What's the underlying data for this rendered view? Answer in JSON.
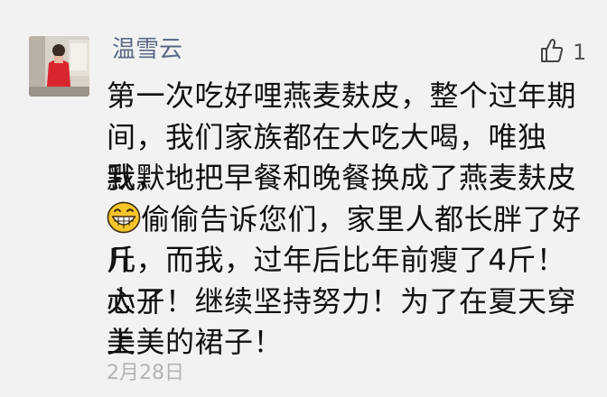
{
  "comment": {
    "username": "温雪云",
    "like_count": "1",
    "date": "2月28日",
    "lines": [
      {
        "text": "第一次吃好哩燕麦麸皮，整个过年期",
        "emoji_before": false,
        "emoji_after": false
      },
      {
        "text": "间，我们家族都在大吃大喝，唯独我，",
        "emoji_before": false,
        "emoji_after": false
      },
      {
        "text": "默默地把早餐和晚餐换成了燕麦麸皮",
        "emoji_before": false,
        "emoji_after": true
      },
      {
        "text": "偷偷告诉您们，家里人都长胖了好几",
        "emoji_before": true,
        "emoji_after": false
      },
      {
        "text": "斤，而我，过年后比年前瘦了4斤！太开",
        "emoji_before": false,
        "emoji_after": false
      },
      {
        "text": "心了！继续坚持努力！为了在夏天穿上",
        "emoji_before": false,
        "emoji_after": false
      },
      {
        "text": "美美的裙子！",
        "emoji_before": false,
        "emoji_after": false
      }
    ],
    "emoji_icon": "grin-emoji-icon",
    "like_icon": "thumbs-up-icon"
  },
  "colors": {
    "background": "#f2f2f2",
    "username": "#5b6b85",
    "text": "#111111",
    "date": "#b3b3b3",
    "emoji_face": "#f7c52a"
  }
}
